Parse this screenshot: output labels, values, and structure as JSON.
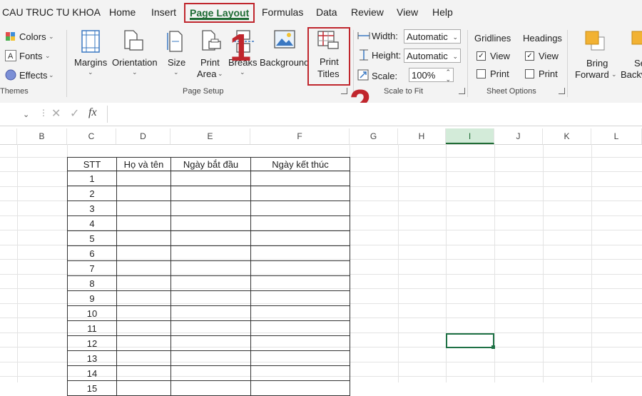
{
  "menu": {
    "items": [
      "CAU TRUC TU KHOA",
      "Home",
      "Insert",
      "Page Layout",
      "Formulas",
      "Data",
      "Review",
      "View",
      "Help"
    ],
    "active": "Page Layout"
  },
  "ribbon": {
    "themes": {
      "colors": "Colors",
      "fonts": "Fonts",
      "effects": "Effects",
      "label": "Themes"
    },
    "page_setup": {
      "margins": "Margins",
      "orientation": "Orientation",
      "size": "Size",
      "print_area_1": "Print",
      "print_area_2": "Area",
      "breaks": "Breaks",
      "background": "Background",
      "print_titles_1": "Print",
      "print_titles_2": "Titles",
      "label": "Page Setup"
    },
    "scale_to_fit": {
      "width_label": "Width:",
      "width_value": "Automatic",
      "height_label": "Height:",
      "height_value": "Automatic",
      "scale_label": "Scale:",
      "scale_value": "100%",
      "label": "Scale to Fit"
    },
    "sheet_options": {
      "gridlines": "Gridlines",
      "headings": "Headings",
      "view": "View",
      "print": "Print",
      "gridlines_view_checked": true,
      "gridlines_print_checked": false,
      "headings_view_checked": true,
      "headings_print_checked": false,
      "label": "Sheet Options"
    },
    "arrange": {
      "bring_1": "Bring",
      "bring_2": "Forward",
      "send_1": "Se",
      "send_2": "Backw"
    }
  },
  "annotations": {
    "step1": "1",
    "step2": "2"
  },
  "formula_bar": {
    "fx": "fx",
    "value": ""
  },
  "columns": [
    "B",
    "C",
    "D",
    "E",
    "F",
    "G",
    "H",
    "I",
    "J",
    "K",
    "L"
  ],
  "selected_column": "I",
  "table": {
    "headers": [
      "STT",
      "Họ và tên",
      "Ngày bắt đầu",
      "Ngày kết thúc"
    ],
    "rows": [
      "1",
      "2",
      "3",
      "4",
      "5",
      "6",
      "7",
      "8",
      "9",
      "10",
      "11",
      "12",
      "13",
      "14",
      "15"
    ]
  }
}
